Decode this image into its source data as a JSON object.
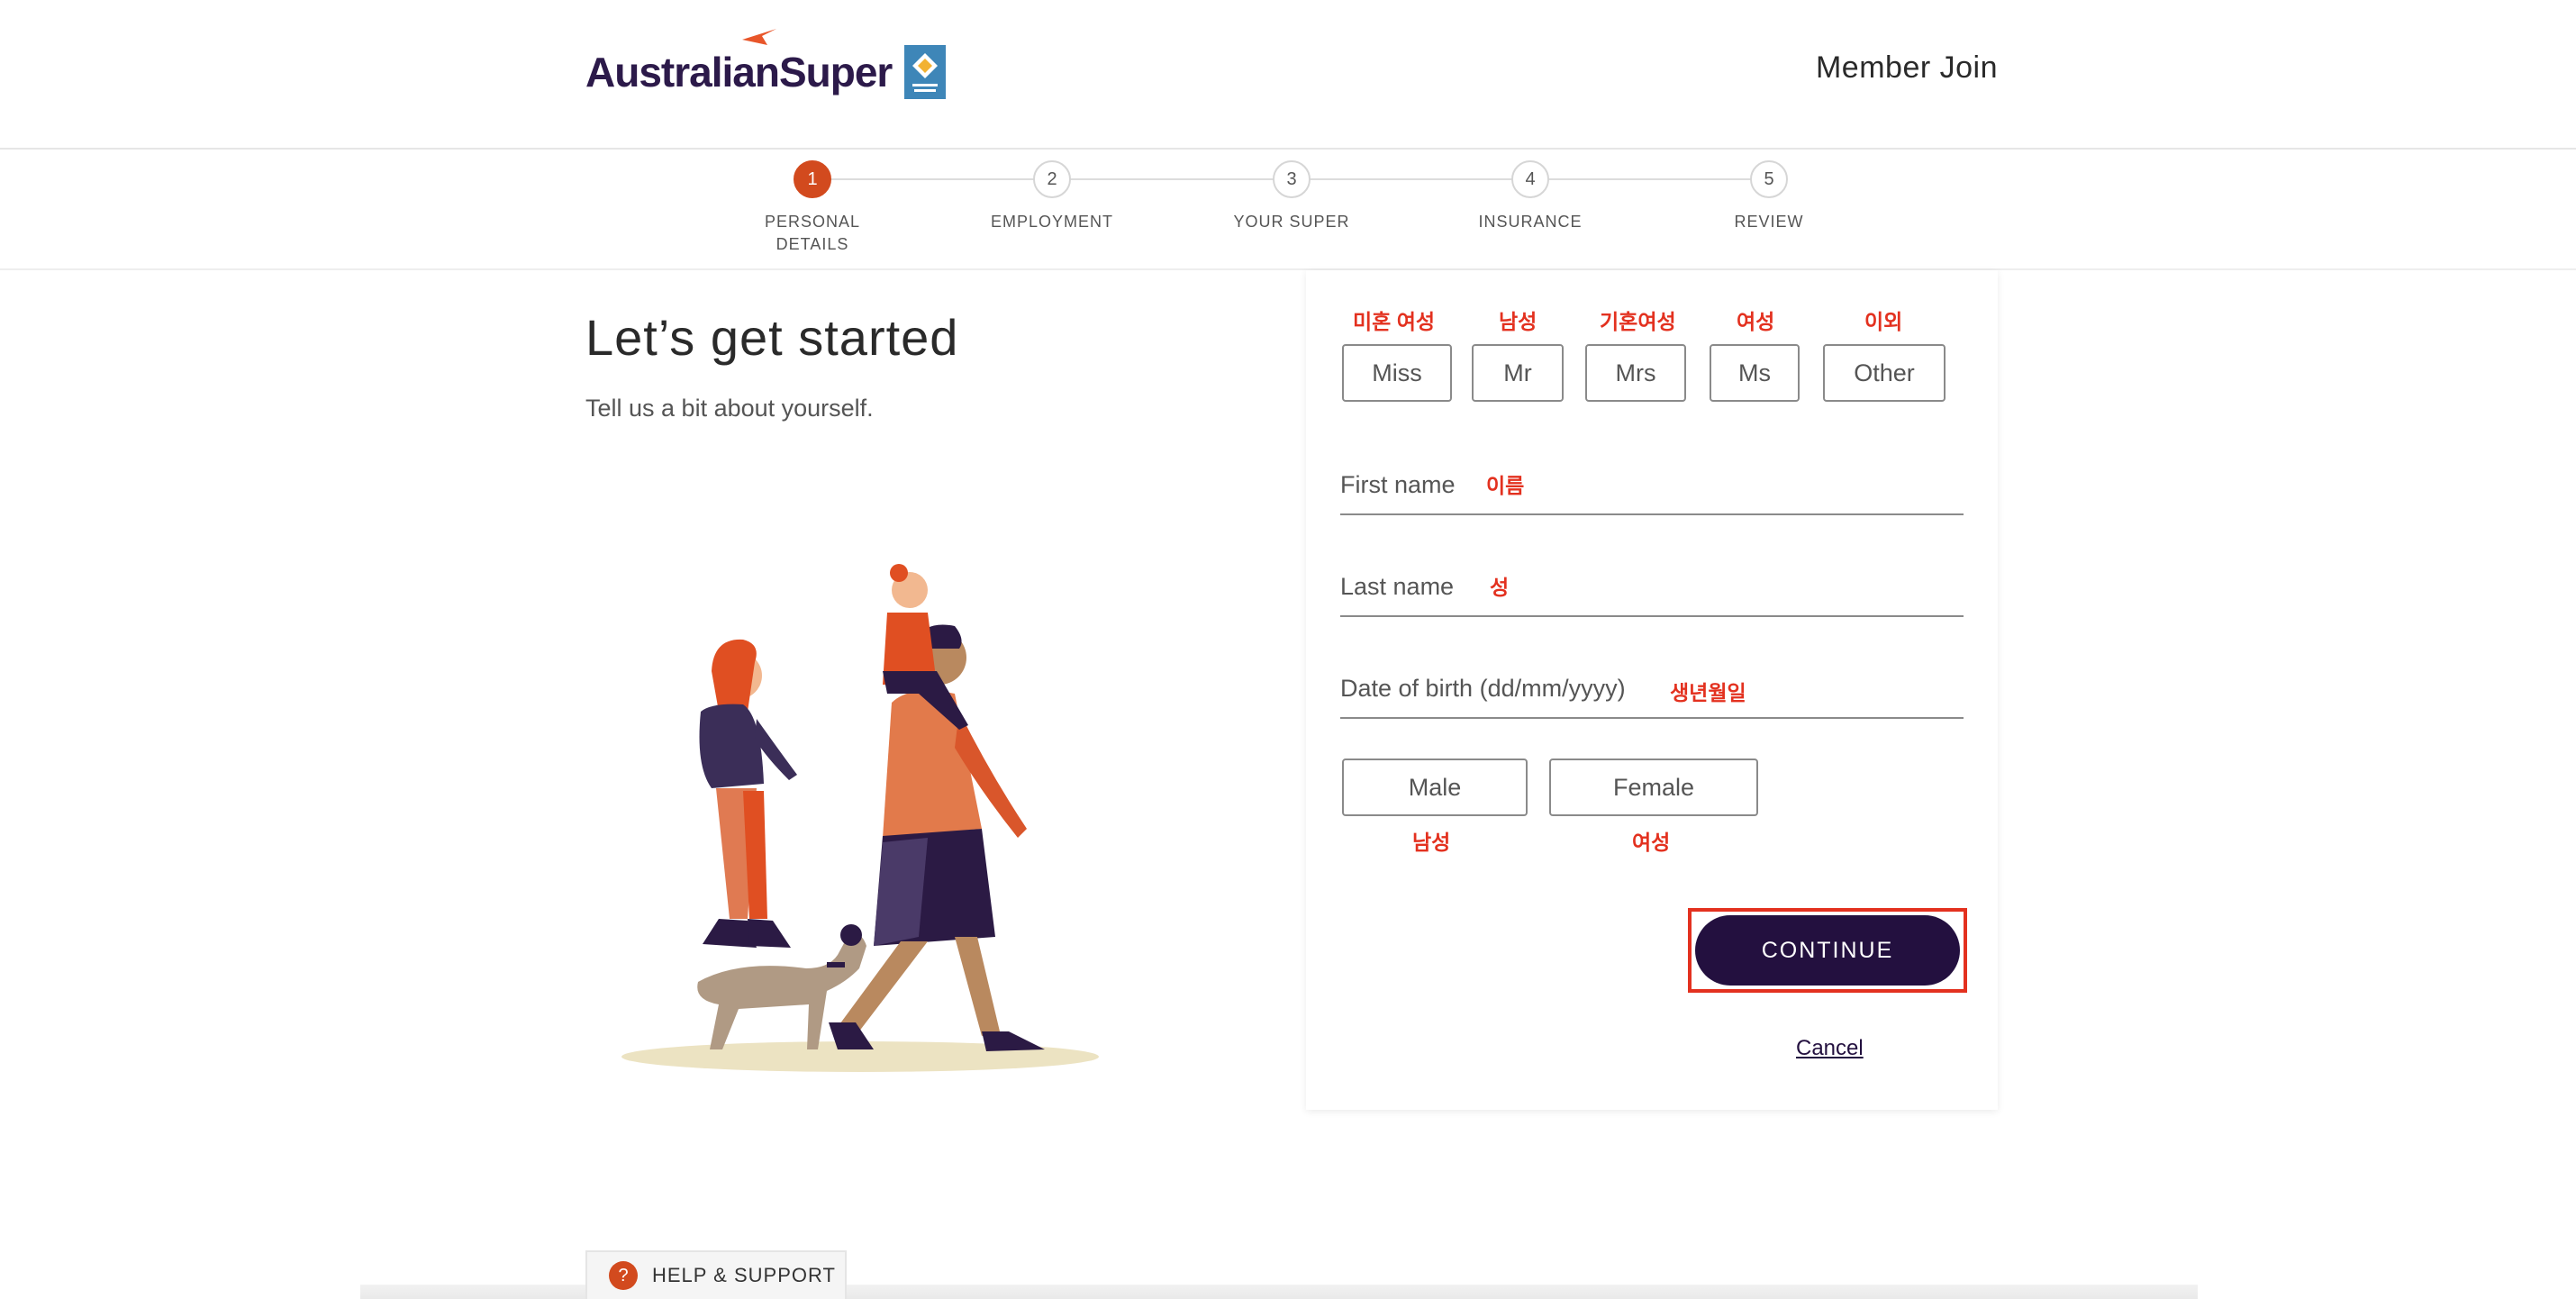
{
  "header": {
    "logo_text": "AustralianSuper",
    "title": "Member Join"
  },
  "stepper": {
    "steps": [
      {
        "number": "1",
        "label": "PERSONAL",
        "label2": "DETAILS",
        "active": true
      },
      {
        "number": "2",
        "label": "EMPLOYMENT"
      },
      {
        "number": "3",
        "label": "YOUR SUPER"
      },
      {
        "number": "4",
        "label": "INSURANCE"
      },
      {
        "number": "5",
        "label": "REVIEW"
      }
    ]
  },
  "intro": {
    "title": "Let’s get started",
    "subtitle": "Tell us a bit about yourself."
  },
  "form": {
    "titles": [
      {
        "label": "Miss",
        "annotation": "미혼 여성"
      },
      {
        "label": "Mr",
        "annotation": "남성"
      },
      {
        "label": "Mrs",
        "annotation": "기혼여성"
      },
      {
        "label": "Ms",
        "annotation": "여성"
      },
      {
        "label": "Other",
        "annotation": "이외"
      }
    ],
    "first_name": {
      "label": "First name",
      "annotation": "이름"
    },
    "last_name": {
      "label": "Last name",
      "annotation": "성"
    },
    "dob": {
      "label": "Date of birth (dd/mm/yyyy)",
      "annotation": "생년월일"
    },
    "gender": [
      {
        "label": "Male",
        "annotation": "남성"
      },
      {
        "label": "Female",
        "annotation": "여성"
      }
    ],
    "continue_label": "CONTINUE",
    "cancel_label": "Cancel"
  },
  "help": {
    "icon": "?",
    "label": "HELP & SUPPORT"
  },
  "colors": {
    "accent": "#d24a1e",
    "primary": "#23103f",
    "annotation": "#e3311f"
  }
}
